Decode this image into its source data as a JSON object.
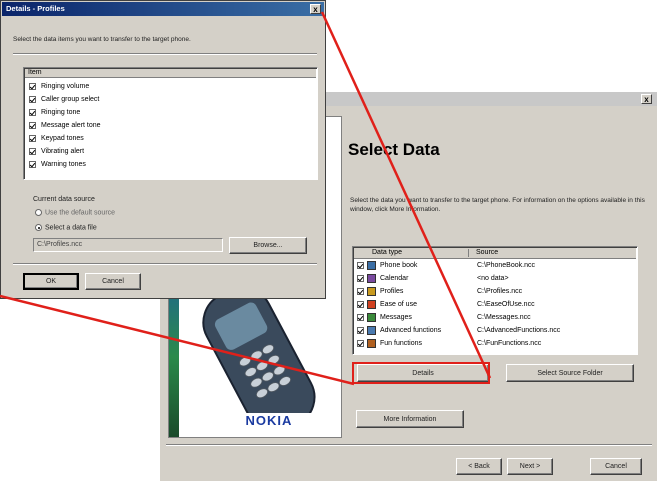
{
  "main_dialog": {
    "heading": "Select Data",
    "description": "Select the data you want to transfer to the target phone. For information on the options available in this window, click More Information.",
    "table": {
      "col_type": "Data type",
      "col_source": "Source",
      "rows": [
        {
          "type": "Phone book",
          "source": "C:\\PhoneBook.ncc"
        },
        {
          "type": "Calendar",
          "source": "<no data>"
        },
        {
          "type": "Profiles",
          "source": "C:\\Profiles.ncc"
        },
        {
          "type": "Ease of use",
          "source": "C:\\EaseOfUse.ncc"
        },
        {
          "type": "Messages",
          "source": "C:\\Messages.ncc"
        },
        {
          "type": "Advanced functions",
          "source": "C:\\AdvancedFunctions.ncc"
        },
        {
          "type": "Fun functions",
          "source": "C:\\FunFunctions.ncc"
        }
      ]
    },
    "details_label": "Details",
    "select_source_label": "Select Source Folder",
    "more_info_label": "More Information",
    "back_label": "< Back",
    "next_label": "Next >",
    "cancel_label": "Cancel",
    "close_glyph": "x",
    "brand": "NOKIA"
  },
  "details_dialog": {
    "title": "Details - Profiles",
    "instruction": "Select the data items you want to transfer to the target phone.",
    "list_header": "Item",
    "items": [
      "Ringing volume",
      "Caller group select",
      "Ringing tone",
      "Message alert tone",
      "Keypad tones",
      "Vibrating alert",
      "Warning tones"
    ],
    "source_label": "Current data source",
    "option_default": "Use the default source",
    "option_file": "Select a data file",
    "file_value": "C:\\Profiles.ncc",
    "browse_label": "Browse...",
    "ok_label": "OK",
    "cancel_label": "Cancel",
    "close_glyph": "x"
  },
  "colors": {
    "highlight": "#e0201a",
    "titlebar": "#0a246a",
    "dialog_bg": "#d4d0c8"
  }
}
